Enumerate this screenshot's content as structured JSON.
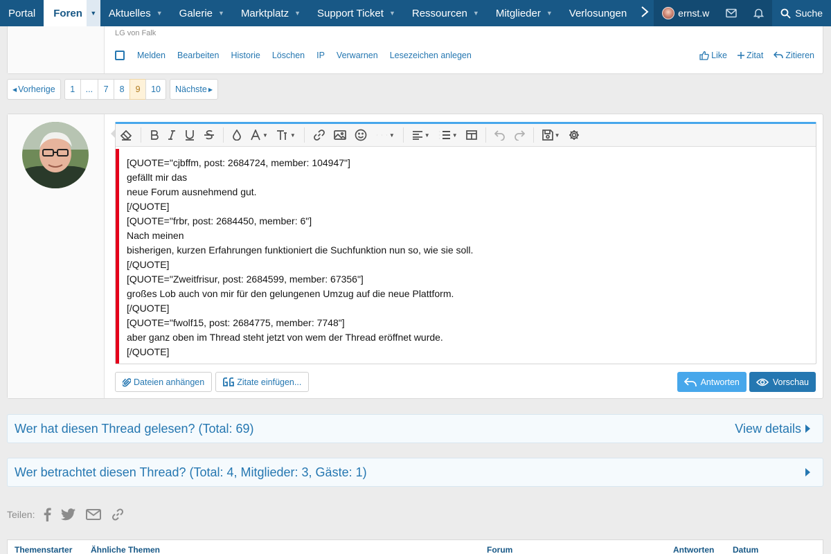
{
  "nav": {
    "items": [
      {
        "label": "Portal",
        "caret": false
      },
      {
        "label": "Foren",
        "caret": true,
        "active": true
      },
      {
        "label": "Aktuelles",
        "caret": true
      },
      {
        "label": "Galerie",
        "caret": true
      },
      {
        "label": "Marktplatz",
        "caret": true
      },
      {
        "label": "Support Ticket",
        "caret": true
      },
      {
        "label": "Ressourcen",
        "caret": true
      },
      {
        "label": "Mitglieder",
        "caret": true
      },
      {
        "label": "Verlosungen",
        "caret": false
      }
    ],
    "username": "ernst.w",
    "search": "Suche"
  },
  "prev_post": {
    "signature": "LG von Falk",
    "actions": [
      "Melden",
      "Bearbeiten",
      "Historie",
      "Löschen",
      "IP",
      "Verwarnen",
      "Lesezeichen anlegen"
    ],
    "like": "Like",
    "zitat": "Zitat",
    "zitieren": "Zitieren"
  },
  "pagination": {
    "prev": "Vorherige",
    "pages": [
      "1",
      "...",
      "7",
      "8",
      "9",
      "10"
    ],
    "current": "9",
    "next": "Nächste"
  },
  "editor": {
    "lines": [
      "[QUOTE=\"cjbffm, post: 2684724, member: 104947\"]",
      "gefällt mir das",
      "neue Forum ausnehmend gut.",
      "[/QUOTE]",
      "[QUOTE=\"frbr, post: 2684450, member: 6\"]",
      "Nach meinen",
      "bisherigen, kurzen Erfahrungen funktioniert die Suchfunktion nun so, wie sie soll.",
      "[/QUOTE]",
      "[QUOTE=\"Zweitfrisur, post: 2684599, member: 67356\"]",
      "großes Lob auch von mir für den gelungenen Umzug auf die neue Plattform.",
      "[/QUOTE]",
      "[QUOTE=\"fwolf15, post: 2684775, member: 7748\"]",
      "aber ganz oben im Thread steht jetzt von wem der Thread eröffnet wurde.",
      "[/QUOTE]"
    ],
    "attach": "Dateien anhängen",
    "insert_quotes": "Zitate einfügen...",
    "reply": "Antworten",
    "preview": "Vorschau",
    "accent_color": "#47a7eb",
    "highlight_color": "#e4001b"
  },
  "readers": {
    "title": "Wer hat diesen Thread gelesen? (Total: 69)",
    "details": "View details"
  },
  "viewers": {
    "title": "Wer betrachtet diesen Thread? (Total: 4, Mitglieder: 3, Gäste: 1)"
  },
  "share": {
    "label": "Teilen:"
  },
  "similar": {
    "columns": [
      "Themenstarter",
      "Ähnliche Themen",
      "Forum",
      "Antworten",
      "Datum"
    ]
  }
}
